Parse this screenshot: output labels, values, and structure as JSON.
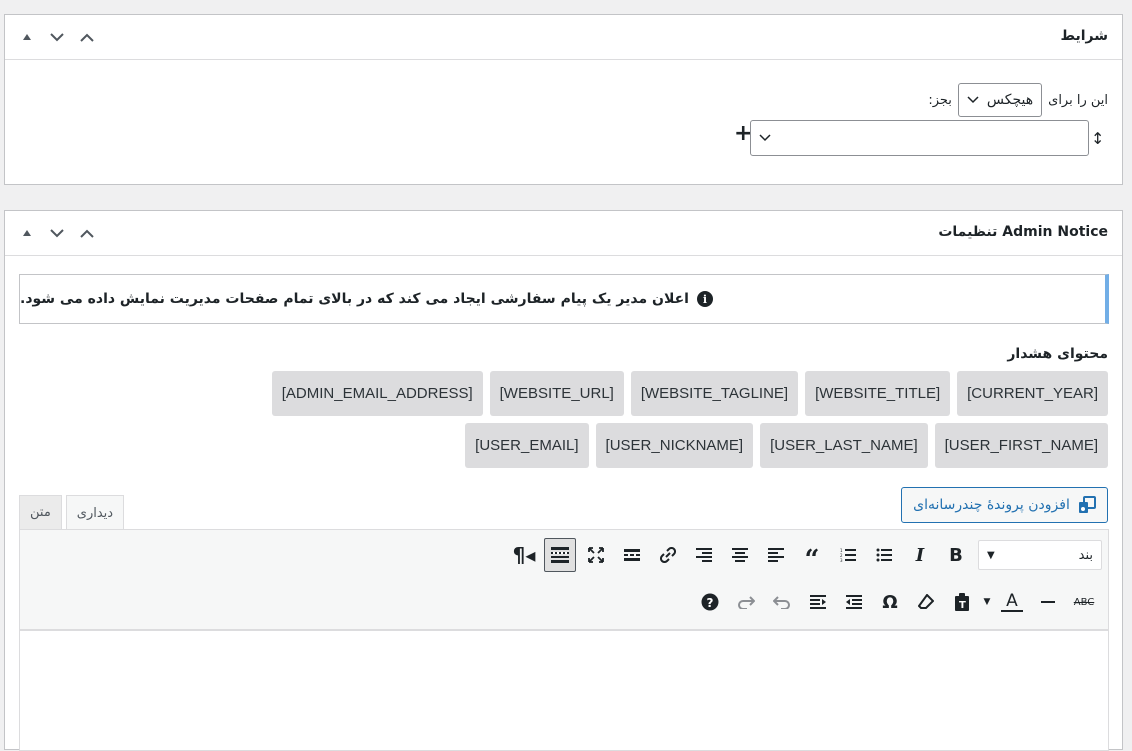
{
  "conditions_panel": {
    "title": "شرایط",
    "prefix_label": "این را برای",
    "select_value": "هیچکس",
    "suffix_label": "بجز:",
    "second_select_value": ""
  },
  "admin_panel": {
    "title": "Admin Notice تنظیمات",
    "notice_text": "اعلان مدیر یک پیام سفارشی ایجاد می کند که در بالای تمام صفحات مدیریت نمایش داده می شود.",
    "content_label": "محتوای هشدار",
    "tags": [
      "[CURRENT_YEAR]",
      "[WEBSITE_TITLE]",
      "[WEBSITE_TAGLINE]",
      "[WEBSITE_URL]",
      "[ADMIN_EMAIL_ADDRESS]",
      "[USER_FIRST_NAME]",
      "[USER_LAST_NAME]",
      "[USER_NICKNAME]",
      "[USER_EMAIL]"
    ],
    "media_button": "افزودن پروندهٔ چندرسانه‌ای",
    "tabs": {
      "visual": "دیداری",
      "text": "متن"
    },
    "format_select": "بند"
  },
  "icons": [
    "arrow-up-small-icon",
    "chevron-down-icon",
    "chevron-up-icon",
    "info-icon",
    "plus-icon",
    "sort-icon",
    "media-icon"
  ],
  "colors": {
    "accent": "#2271b1",
    "notice_border": "#72aee6",
    "tag_bg": "#dcdcde"
  }
}
